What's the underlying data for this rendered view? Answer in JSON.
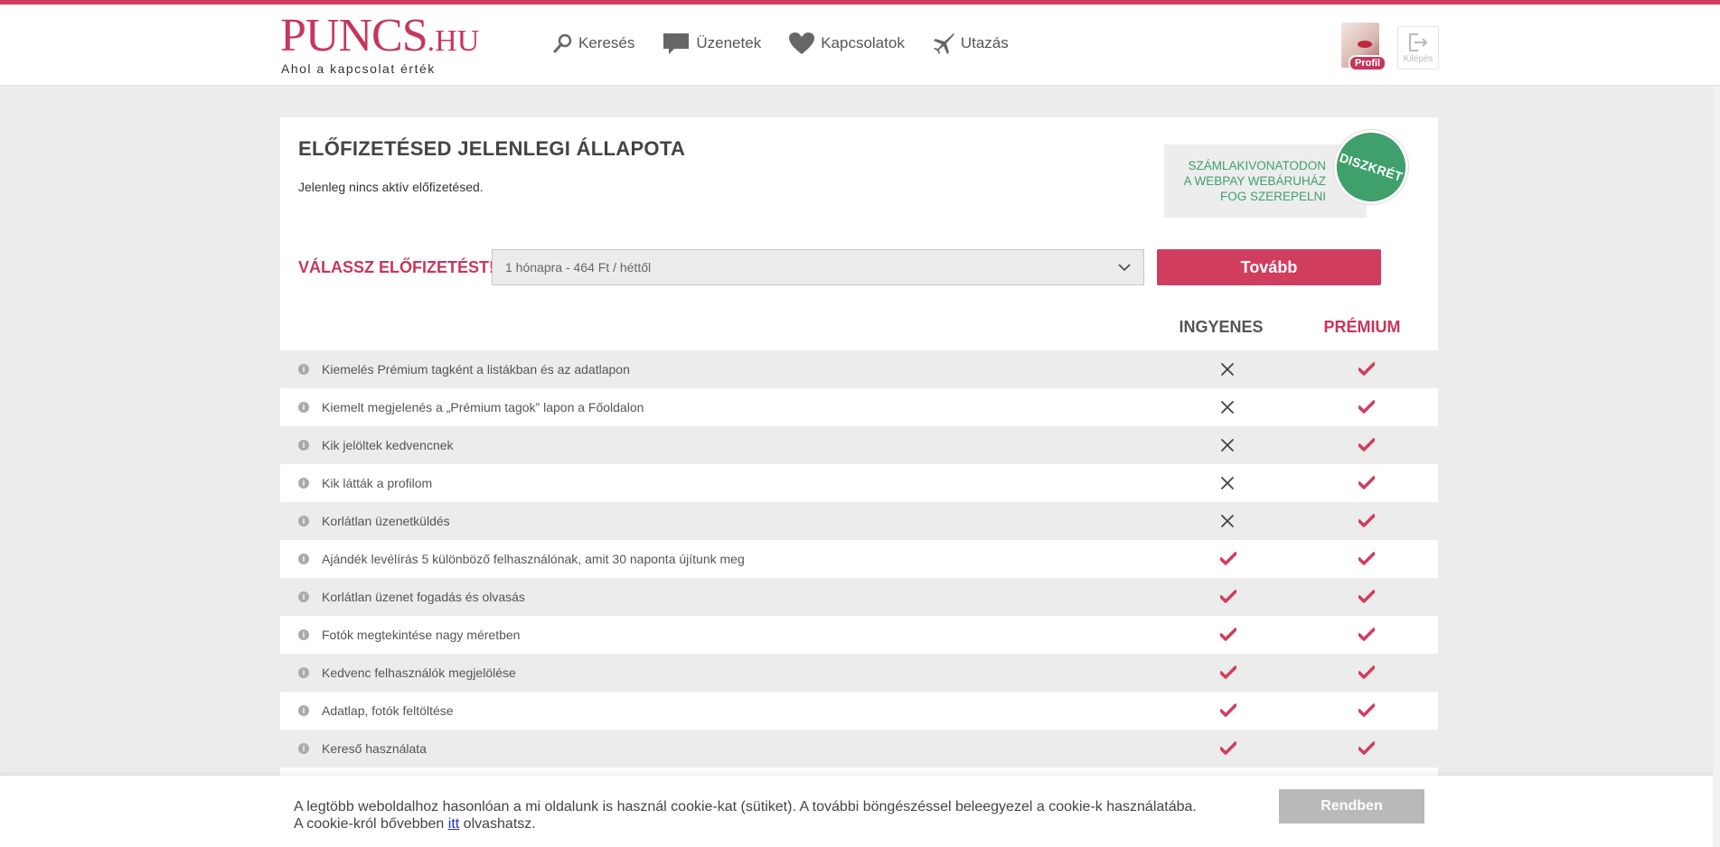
{
  "header": {
    "logo_main": "PUNCS",
    "logo_tld": ".HU",
    "logo_tagline": "Ahol a kapcsolat érték",
    "nav": [
      {
        "label": "Keresés",
        "icon": "search-icon"
      },
      {
        "label": "Üzenetek",
        "icon": "message-icon"
      },
      {
        "label": "Kapcsolatok",
        "icon": "heart-icon"
      },
      {
        "label": "Utazás",
        "icon": "plane-icon"
      }
    ],
    "profile_badge": "Profil",
    "logout_label": "Kilépés"
  },
  "subscription": {
    "title": "ELŐFIZETÉSED JELENLEGI ÁLLAPOTA",
    "status": "Jelenleg nincs aktív előfizetésed.",
    "discrete_line1": "SZÁMLAKIVONATODON",
    "discrete_line2": "A WEBPAY WEBÁRUHÁZ",
    "discrete_line3": "FOG SZEREPELNI",
    "discrete_badge": "DISZKRÉT",
    "choose_label": "VÁLASSZ ELŐFIZETÉST!",
    "selected_plan": "1 hónapra - 464 Ft / héttől",
    "next_button": "Tovább",
    "col_free": "INGYENES",
    "col_premium": "PRÉMIUM"
  },
  "features": [
    {
      "label": "Kiemelés Prémium tagként a listákban és az adatlapon",
      "free": false,
      "premium": true
    },
    {
      "label": "Kiemelt megjelenés a „Prémium tagok” lapon a Főoldalon",
      "free": false,
      "premium": true
    },
    {
      "label": "Kik jelöltek kedvencnek",
      "free": false,
      "premium": true
    },
    {
      "label": "Kik látták a profilom",
      "free": false,
      "premium": true
    },
    {
      "label": "Korlátlan üzenetküldés",
      "free": false,
      "premium": true
    },
    {
      "label": "Ajándék levélírás 5 különböző felhasználónak, amit 30 naponta újítunk meg",
      "free": true,
      "premium": true
    },
    {
      "label": "Korlátlan üzenet fogadás és olvasás",
      "free": true,
      "premium": true
    },
    {
      "label": "Fotók megtekintése nagy méretben",
      "free": true,
      "premium": true
    },
    {
      "label": "Kedvenc felhasználók megjelölése",
      "free": true,
      "premium": true
    },
    {
      "label": "Adatlap, fotók feltöltése",
      "free": true,
      "premium": true
    },
    {
      "label": "Kereső használata",
      "free": true,
      "premium": true
    }
  ],
  "cookie": {
    "text_line1": "A legtöbb weboldalhoz hasonlóan a mi oldalunk is használ cookie-kat (sütiket). A további böngészéssel beleegyezel a cookie-k használatába.",
    "text_line2_prefix": "A cookie-król bővebben ",
    "link": "itt",
    "text_line2_suffix": " olvashatsz.",
    "button": "Rendben"
  },
  "colors": {
    "brand": "#d13d5e",
    "discrete_green": "#3fa06b",
    "cross": "#444444"
  }
}
